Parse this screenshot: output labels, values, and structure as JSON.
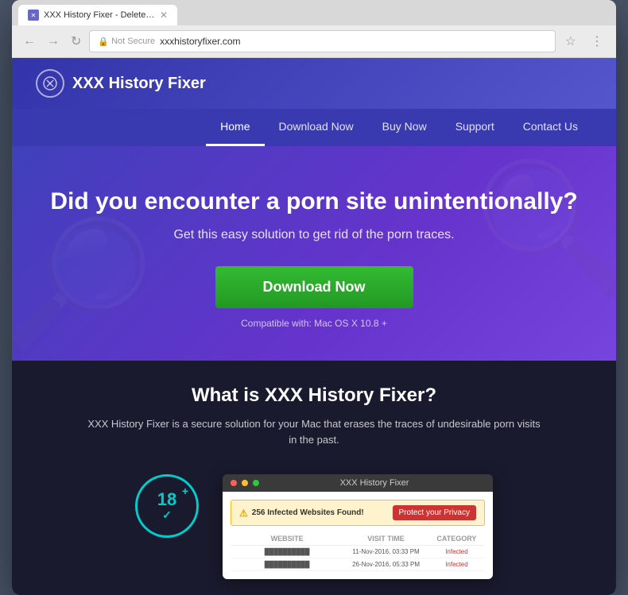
{
  "browser": {
    "tab_title": "XXX History Fixer - Delete tra...",
    "tab_favicon": "✕",
    "address_bar_security": "Not Secure",
    "url": "xxxhistoryfixer.com",
    "back_label": "←",
    "forward_label": "→",
    "reload_label": "↻"
  },
  "site": {
    "logo_text": "XXX History Fixer",
    "logo_icon": "✕"
  },
  "nav": {
    "items": [
      {
        "label": "Home",
        "active": true
      },
      {
        "label": "Download Now",
        "active": false
      },
      {
        "label": "Buy Now",
        "active": false
      },
      {
        "label": "Support",
        "active": false
      },
      {
        "label": "Contact Us",
        "active": false
      }
    ]
  },
  "hero": {
    "title": "Did you encounter a porn site unintentionally?",
    "subtitle": "Get this easy solution to get rid of the porn traces.",
    "download_btn": "Download Now",
    "compatible": "Compatible with: Mac OS X 10.8 +"
  },
  "what_section": {
    "title": "What is XXX History Fixer?",
    "description": "XXX History Fixer is a secure solution for your Mac that erases the traces of undesirable porn visits in the past.",
    "age_badge": "18+",
    "app_window_title": "XXX History Fixer",
    "warning_text": "256 Infected Websites Found!",
    "protect_btn": "Protect your Privacy",
    "table_headers": [
      "Website",
      "Visit Time",
      "Category"
    ],
    "table_rows": [
      {
        "website": "██████████",
        "time": "11-Nov-2016, 03:33 PM",
        "category": "Infected"
      },
      {
        "website": "██████████",
        "time": "26-Nov-2016, 05:33 PM",
        "category": "Infected"
      }
    ]
  }
}
